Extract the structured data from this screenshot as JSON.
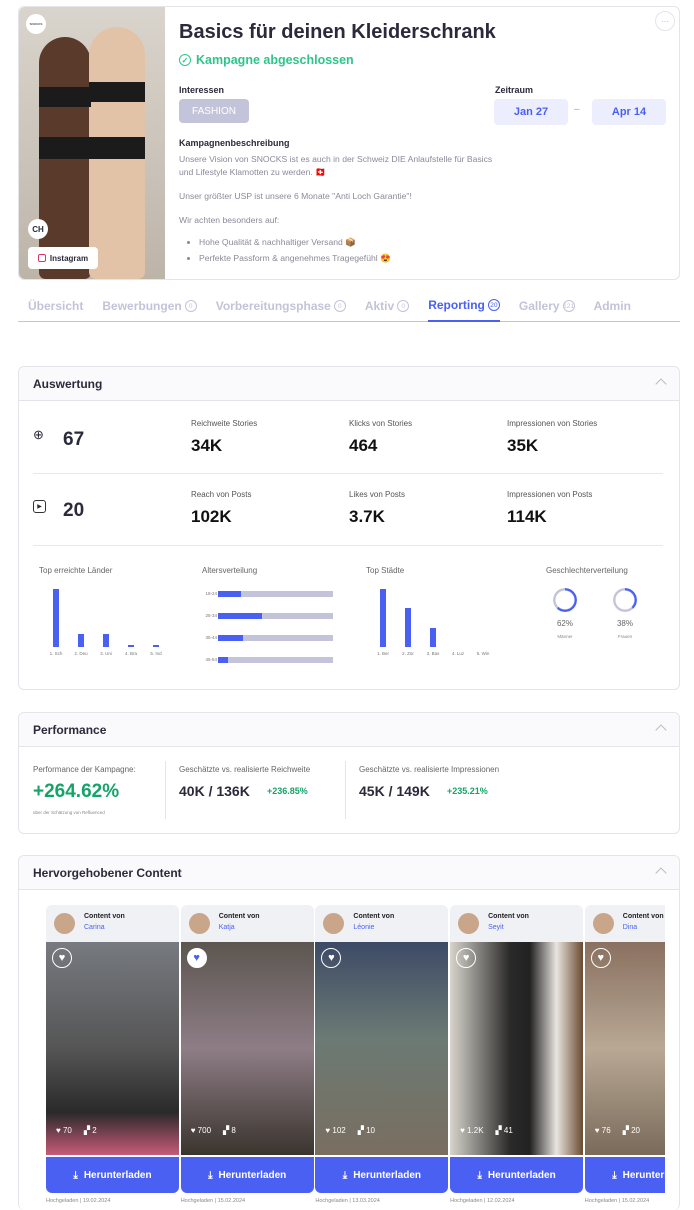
{
  "campaign": {
    "title": "Basics für deinen Kleiderschrank",
    "status": "Kampagne abgeschlossen",
    "logo_text": "SNOCKS",
    "country": "CH",
    "platform": "Instagram",
    "interests_label": "Interessen",
    "interest": "FASHION",
    "period_label": "Zeitraum",
    "start": "Jan 27",
    "end": "Apr 14",
    "dash": "–",
    "desc_label": "Kampagnenbeschreibung",
    "desc_p1": "Unsere Vision von SNOCKS ist es auch in der Schweiz DIE Anlaufstelle für Basics und Lifestyle Klamotten zu werden. 🇨🇭",
    "desc_p2": "Unser größter USP ist unsere 6 Monate \"Anti Loch Garantie\"!",
    "desc_p3": "Wir achten besonders auf:",
    "bullets": [
      "Hohe Qualität & nachhaltiger Versand 📦",
      "Perfekte Passform & angenehmes Tragegefühl 😍"
    ],
    "more": "···"
  },
  "tabs": [
    {
      "label": "Übersicht"
    },
    {
      "label": "Bewerbungen",
      "count": "0"
    },
    {
      "label": "Vorbereitungsphase",
      "count": "0"
    },
    {
      "label": "Aktiv",
      "count": "0"
    },
    {
      "label": "Reporting",
      "count": "20",
      "active": true
    },
    {
      "label": "Gallery",
      "count": "121"
    },
    {
      "label": "Admin"
    }
  ],
  "auswertung": {
    "title": "Auswertung",
    "stories": {
      "count": "67",
      "metrics": [
        {
          "label": "Reichweite Stories",
          "value": "34K"
        },
        {
          "label": "Klicks von Stories",
          "value": "464"
        },
        {
          "label": "Impressionen von Stories",
          "value": "35K"
        }
      ]
    },
    "posts": {
      "count": "20",
      "metrics": [
        {
          "label": "Reach von Posts",
          "value": "102K"
        },
        {
          "label": "Likes von Posts",
          "value": "3.7K"
        },
        {
          "label": "Impressionen von Posts",
          "value": "114K"
        }
      ]
    }
  },
  "chart_data": [
    {
      "type": "bar",
      "title": "Top erreichte Länder",
      "categories": [
        "1. Sch",
        "2. Deu",
        "3. Uni",
        "4. Bra",
        "5. Ind"
      ],
      "values": [
        100,
        22,
        22,
        4,
        4
      ]
    },
    {
      "type": "bar",
      "orientation": "horizontal",
      "title": "Altersverteilung",
      "categories": [
        "18-24",
        "25-34",
        "35-44",
        "45-54"
      ],
      "values": [
        20,
        38,
        22,
        9
      ],
      "ylim": [
        0,
        100
      ]
    },
    {
      "type": "bar",
      "title": "Top Städte",
      "categories": [
        "1. Ber",
        "2. Zür",
        "3. Bas",
        "4. Luz",
        "5. Win"
      ],
      "values": [
        100,
        67,
        33,
        0,
        0
      ]
    },
    {
      "type": "pie",
      "title": "Geschlechterverteilung",
      "categories": [
        "Männer",
        "Frauen"
      ],
      "values": [
        62,
        38
      ],
      "labels": [
        "62%",
        "38%"
      ]
    }
  ],
  "performance": {
    "title": "Performance",
    "campaign_label": "Performance der Kampagne:",
    "campaign_value": "+264.62%",
    "campaign_note": "über der Schätzung von Refluenced",
    "reach_label": "Geschätzte vs. realisierte Reichweite",
    "reach_value": "40K / 136K",
    "reach_delta": "+236.85%",
    "impr_label": "Geschätzte vs. realisierte Impressionen",
    "impr_value": "45K / 149K",
    "impr_delta": "+235.21%"
  },
  "content": {
    "title": "Hervorgehobener Content",
    "by": "Content von",
    "download": "Herunterladen",
    "items": [
      {
        "name": "Carina",
        "likes": "70",
        "comments": "2",
        "uploaded": "Hochgeladen | 19.02.2024",
        "liked": false
      },
      {
        "name": "Katja",
        "likes": "700",
        "comments": "8",
        "uploaded": "Hochgeladen | 15.02.2024",
        "liked": true
      },
      {
        "name": "Léonie",
        "likes": "102",
        "comments": "10",
        "uploaded": "Hochgeladen | 13.03.2024",
        "liked": false
      },
      {
        "name": "Seyit",
        "likes": "1.2K",
        "comments": "41",
        "uploaded": "Hochgeladen | 12.02.2024",
        "liked": false
      },
      {
        "name": "Dina",
        "likes": "76",
        "comments": "20",
        "uploaded": "Hochgeladen | 15.02.2024",
        "liked": false
      }
    ]
  },
  "colors": {
    "accent": "#4a60f2",
    "success": "#2fc48b",
    "muted": "#c3c3d9"
  }
}
